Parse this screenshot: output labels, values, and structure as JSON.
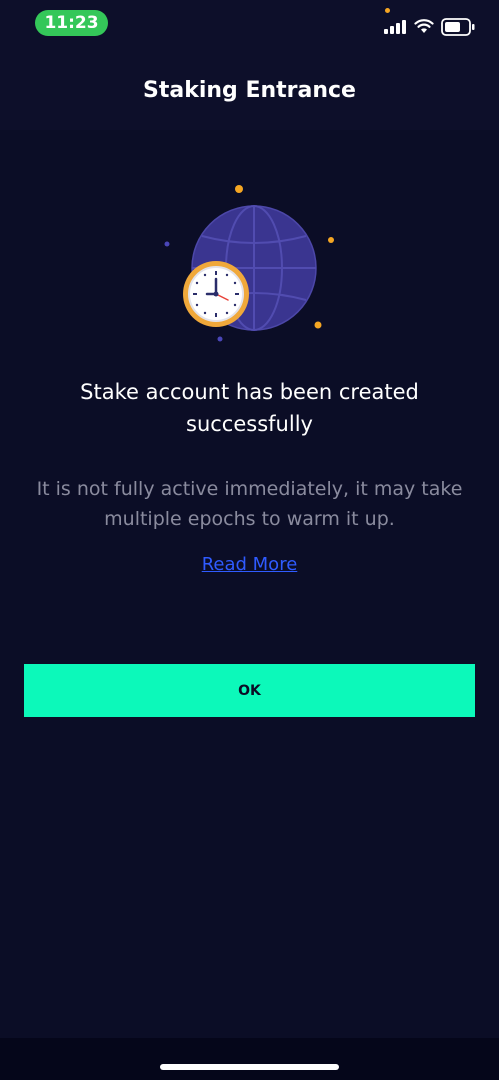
{
  "status_bar": {
    "time": "11:23",
    "icons": [
      "signal-icon",
      "wifi-icon",
      "battery-icon"
    ]
  },
  "header": {
    "title": "Staking Entrance"
  },
  "illustration": {
    "icons": [
      "globe-icon",
      "clock-icon"
    ]
  },
  "content": {
    "headline": "Stake account has been created successfully",
    "description": "It is not fully active immediately, it may take multiple epochs to warm it up.",
    "read_more_label": "Read More"
  },
  "actions": {
    "ok_label": "OK"
  },
  "colors": {
    "background": "#0b0d26",
    "accent": "#0cf9ba",
    "link": "#2f5bff",
    "status_pill": "#34c759",
    "orange_dot": "#f5a623",
    "globe": "#3a3590"
  }
}
